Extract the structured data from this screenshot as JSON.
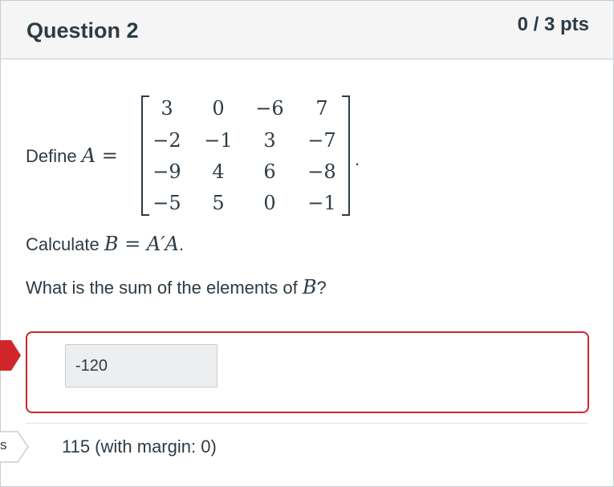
{
  "question": {
    "title": "Question 2",
    "points": "0 / 3 pts"
  },
  "prompt": {
    "define_prefix": "Define ",
    "define_var": "A",
    "equals": " = ",
    "matrix": [
      [
        "3",
        "0",
        "−6",
        "7"
      ],
      [
        "−2",
        "−1",
        "3",
        "−7"
      ],
      [
        "−9",
        "4",
        "6",
        "−8"
      ],
      [
        "−5",
        "5",
        "0",
        "−1"
      ]
    ],
    "matrix_end": ".",
    "calc_prefix": "Calculate ",
    "calc_expr_b": "B",
    "calc_expr_eq": " = ",
    "calc_expr_a": "A′A",
    "calc_suffix": ".",
    "sum_prefix": "What is the sum of the elements of ",
    "sum_var": "B",
    "sum_suffix": "?"
  },
  "answer": {
    "value": "-120",
    "status": "incorrect",
    "status_color": "#d0262b"
  },
  "correct": {
    "flag_label": "s",
    "text": "115 (with margin: 0)"
  }
}
